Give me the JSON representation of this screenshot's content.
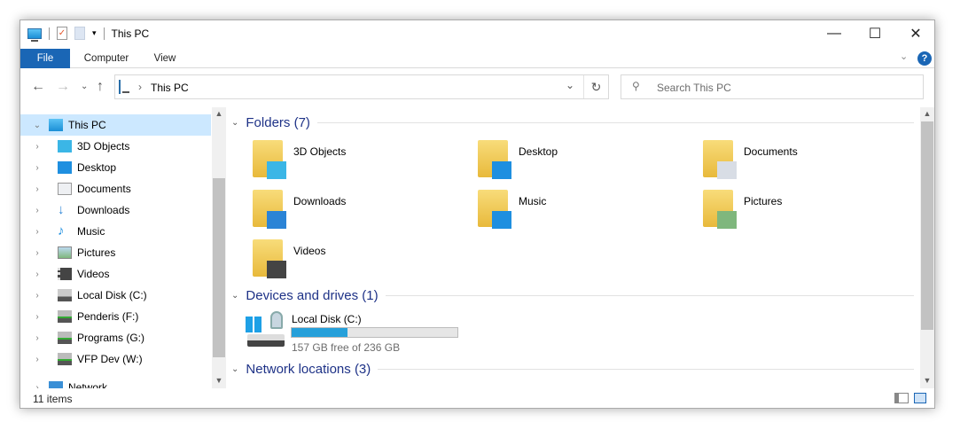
{
  "title": "This PC",
  "ribbon": {
    "file": "File",
    "computer": "Computer",
    "view": "View"
  },
  "address": {
    "path": "This PC",
    "search_placeholder": "Search This PC"
  },
  "sidebar": {
    "items": [
      {
        "label": "This PC",
        "icon": "computer-icon",
        "selected": true
      },
      {
        "label": "3D Objects",
        "icon": "cube-icon"
      },
      {
        "label": "Desktop",
        "icon": "desktop-icon"
      },
      {
        "label": "Documents",
        "icon": "document-icon"
      },
      {
        "label": "Downloads",
        "icon": "download-icon"
      },
      {
        "label": "Music",
        "icon": "music-icon"
      },
      {
        "label": "Pictures",
        "icon": "picture-icon"
      },
      {
        "label": "Videos",
        "icon": "video-icon"
      },
      {
        "label": "Local Disk (C:)",
        "icon": "drive-icon"
      },
      {
        "label": "Penderis (F:)",
        "icon": "network-drive-icon"
      },
      {
        "label": "Programs (G:)",
        "icon": "network-drive-icon"
      },
      {
        "label": "VFP Dev (W:)",
        "icon": "network-drive-icon"
      },
      {
        "label": "Network",
        "icon": "network-icon"
      }
    ]
  },
  "groups": {
    "folders": "Folders (7)",
    "devices": "Devices and drives (1)",
    "network": "Network locations (3)"
  },
  "folders": [
    {
      "label": "3D Objects",
      "color": "#3bb6e6"
    },
    {
      "label": "Desktop",
      "color": "#1e8fe0"
    },
    {
      "label": "Documents",
      "color": "#d8dde5"
    },
    {
      "label": "Downloads",
      "color": "#2b84d6"
    },
    {
      "label": "Music",
      "color": "#1e8fe0"
    },
    {
      "label": "Pictures",
      "color": "#7fb77d"
    },
    {
      "label": "Videos",
      "color": "#444444"
    }
  ],
  "drive": {
    "label": "Local Disk (C:)",
    "free_text": "157 GB free of 236 GB",
    "used_fraction": 0.335,
    "bar_color": "#26a0da"
  },
  "status": {
    "count": "11 items"
  }
}
